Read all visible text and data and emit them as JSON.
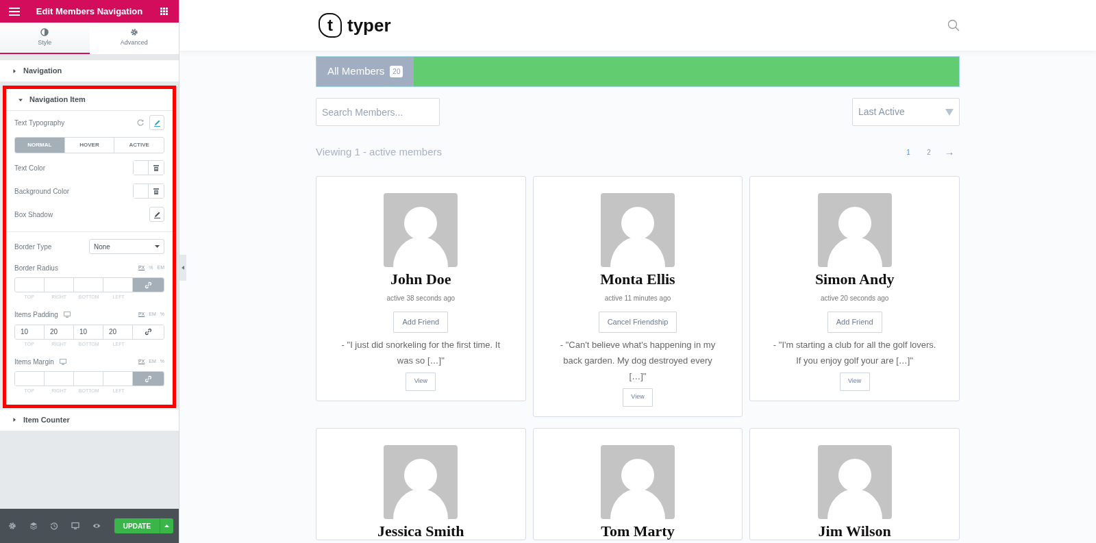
{
  "editor": {
    "title": "Edit Members Navigation",
    "tabs": [
      {
        "label": "Style",
        "kind": "style",
        "selected": true
      },
      {
        "label": "Advanced",
        "kind": "advanced",
        "selected": false
      }
    ],
    "sections": [
      {
        "title": "Navigation",
        "expanded": false,
        "highlighted": false
      },
      {
        "title": "Navigation Item",
        "expanded": true,
        "highlighted": true,
        "controls": [
          {
            "kind": "typography",
            "label": "Text Typography"
          },
          {
            "kind": "states",
            "options": [
              {
                "label": "NORMAL",
                "selected": true
              },
              {
                "label": "HOVER",
                "selected": false
              },
              {
                "label": "ACTIVE",
                "selected": false
              }
            ]
          },
          {
            "kind": "color",
            "label": "Text Color"
          },
          {
            "kind": "color",
            "label": "Background Color"
          },
          {
            "kind": "shadow",
            "label": "Box Shadow"
          },
          {
            "kind": "divider"
          },
          {
            "kind": "select",
            "label": "Border Type",
            "value": "None"
          },
          {
            "kind": "dimensions",
            "label": "Border Radius",
            "responsive": false,
            "linked": true,
            "units": [
              {
                "label": "PX",
                "selected": true
              },
              {
                "label": "%",
                "selected": false
              },
              {
                "label": "EM",
                "selected": false
              }
            ],
            "fields": [
              {
                "label": "TOP"
              },
              {
                "label": "RIGHT"
              },
              {
                "label": "BOTTOM"
              },
              {
                "label": "LEFT"
              }
            ]
          },
          {
            "kind": "dimensions",
            "label": "Items Padding",
            "responsive": true,
            "linked": false,
            "units": [
              {
                "label": "PX",
                "selected": true
              },
              {
                "label": "EM",
                "selected": false
              },
              {
                "label": "%",
                "selected": false
              }
            ],
            "fields": [
              {
                "label": "TOP",
                "value": "10"
              },
              {
                "label": "RIGHT",
                "value": "20"
              },
              {
                "label": "BOTTOM",
                "value": "10"
              },
              {
                "label": "LEFT",
                "value": "20"
              }
            ]
          },
          {
            "kind": "dimensions",
            "label": "Items Margin",
            "responsive": true,
            "linked": true,
            "units": [
              {
                "label": "PX",
                "selected": true
              },
              {
                "label": "EM",
                "selected": false
              },
              {
                "label": "%",
                "selected": false
              }
            ],
            "fields": [
              {
                "label": "TOP"
              },
              {
                "label": "RIGHT"
              },
              {
                "label": "BOTTOM"
              },
              {
                "label": "LEFT"
              }
            ]
          }
        ]
      },
      {
        "title": "Item Counter",
        "expanded": false,
        "highlighted": false
      }
    ],
    "footer": {
      "update_label": "UPDATE"
    }
  },
  "site": {
    "logo": {
      "text": "typer",
      "mark": "t"
    },
    "tabs": [
      {
        "label": "All Members",
        "count": "20",
        "selected": true
      }
    ],
    "search": {
      "placeholder": "Search Members..."
    },
    "sort": {
      "value": "Last Active"
    },
    "viewing": "Viewing 1 - active members",
    "pages": [
      {
        "label": "1",
        "selected": true
      },
      {
        "label": "2",
        "selected": false
      }
    ],
    "next": "→",
    "members": [
      {
        "name": "John Doe",
        "activity": "active 38 seconds ago",
        "action": "Add Friend",
        "excerpt": "- \"I just did snorkeling for the first time. It was so […]\"",
        "view": "View"
      },
      {
        "name": "Monta Ellis",
        "activity": "active 11 minutes ago",
        "action": "Cancel Friendship",
        "excerpt": "- \"Can't believe what's happening in my back garden. My dog destroyed every […]\"",
        "view": "View"
      },
      {
        "name": "Simon Andy",
        "activity": "active 20 seconds ago",
        "action": "Add Friend",
        "excerpt": "- \"I'm starting a club for all the golf lovers. If you enjoy golf your are […]\"",
        "view": "View"
      },
      {
        "name": "Jessica Smith"
      },
      {
        "name": "Tom Marty"
      },
      {
        "name": "Jim Wilson"
      }
    ]
  }
}
